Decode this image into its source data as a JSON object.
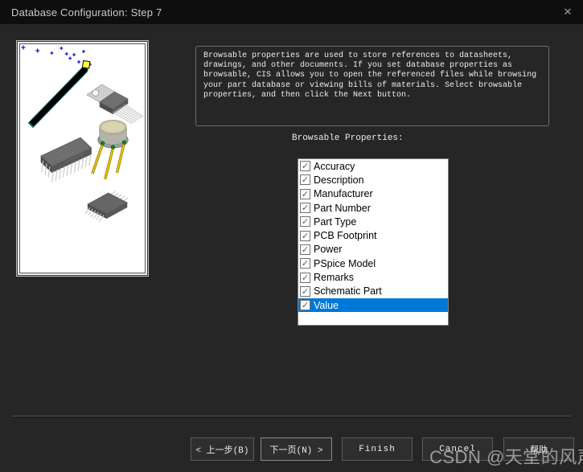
{
  "window": {
    "title": "Database Configuration: Step 7",
    "close_glyph": "✕"
  },
  "description": {
    "text": "Browsable properties are used to store references to datasheets,\ndrawings, and other documents. If you set database properties as\nbrowsable, CIS allows you to open the referenced files while browsing\nyour part database or viewing bills of materials. Select browsable\nproperties, and then click the Next button."
  },
  "list": {
    "label": "Browsable Properties:",
    "check_glyph": "✓",
    "selected_index": 10,
    "selection_color": "#0078d7",
    "items": [
      {
        "label": "Accuracy",
        "checked": true
      },
      {
        "label": "Description",
        "checked": true
      },
      {
        "label": "Manufacturer",
        "checked": true
      },
      {
        "label": "Part Number",
        "checked": true
      },
      {
        "label": "Part Type",
        "checked": true
      },
      {
        "label": "PCB Footprint",
        "checked": true
      },
      {
        "label": "Power",
        "checked": true
      },
      {
        "label": "PSpice Model",
        "checked": true
      },
      {
        "label": "Remarks",
        "checked": true
      },
      {
        "label": "Schematic Part",
        "checked": true
      },
      {
        "label": "Value",
        "checked": true,
        "selected": true
      }
    ]
  },
  "buttons": {
    "back": "< 上一步(B)",
    "next": "下一页(N) >",
    "finish": "Finish",
    "cancel": "Cancel",
    "help": "帮助"
  },
  "watermark": {
    "text": "CSDN @天堂的风声"
  },
  "colors": {
    "titlebar_bg": "#0e0e0e",
    "body_bg": "#262626",
    "selection_blue": "#0078d7",
    "list_bg": "#ffffff"
  }
}
